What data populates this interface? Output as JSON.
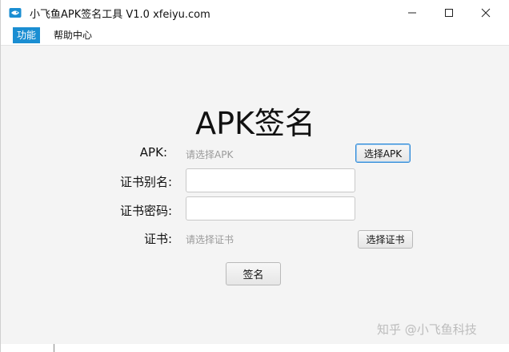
{
  "window": {
    "title": "小飞鱼APK签名工具 V1.0 xfeiyu.com",
    "app_icon": "app-logo-icon",
    "controls": [
      "minimize-icon",
      "maximize-icon",
      "close-icon"
    ]
  },
  "menu": {
    "items": [
      {
        "label": "功能",
        "active": true
      },
      {
        "label": "帮助中心",
        "active": false
      }
    ]
  },
  "main": {
    "heading": "APK签名",
    "apk": {
      "label": "APK:",
      "hint": "请选择APK",
      "button": "选择APK"
    },
    "alias": {
      "label": "证书别名:",
      "value": ""
    },
    "password": {
      "label": "证书密码:",
      "value": ""
    },
    "cert": {
      "label": "证书:",
      "hint": "请选择证书",
      "button": "选择证书"
    },
    "sign_button": "签名"
  },
  "watermark": "知乎 @小飞鱼科技",
  "colors": {
    "accent": "#1a8ed2",
    "background": "#f4f4f4",
    "hint_text": "#9a9a9a"
  }
}
